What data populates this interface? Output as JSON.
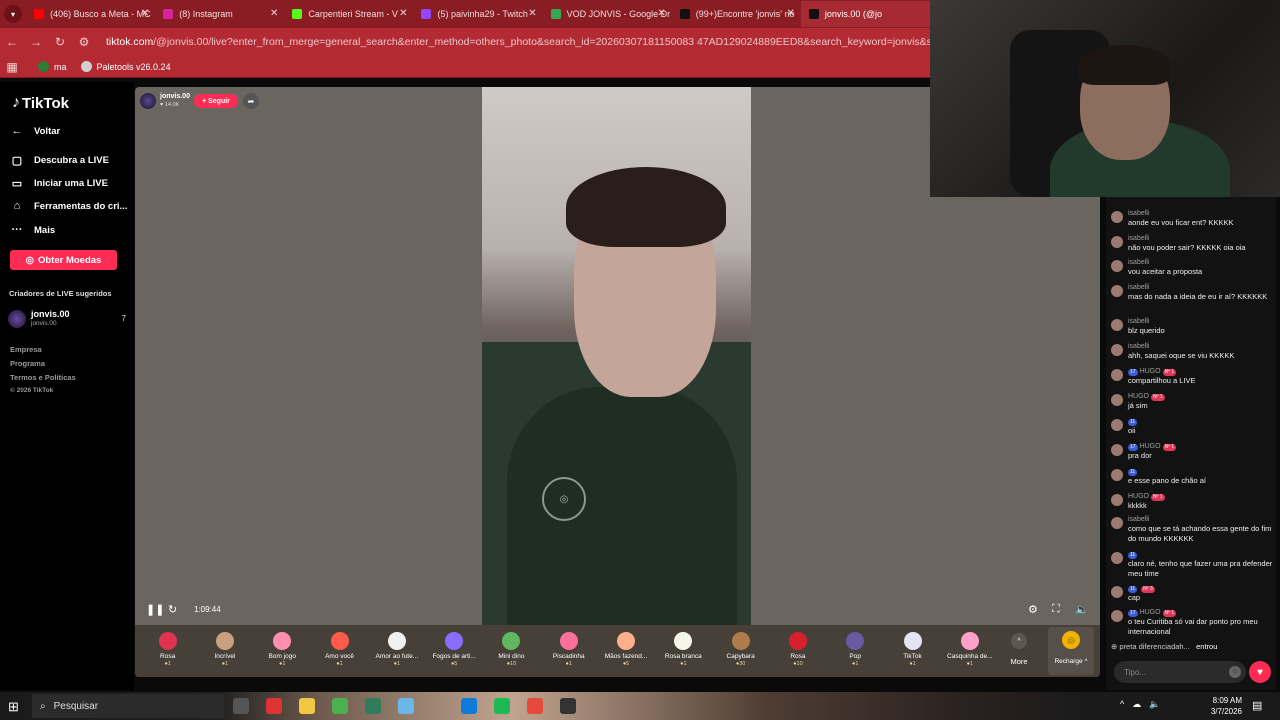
{
  "tabs": [
    {
      "title": "(406) Busco a Meta - MC",
      "color": "#ff0000"
    },
    {
      "title": "(8) Instagram",
      "color": "#d6249f"
    },
    {
      "title": "Carpentieri Stream - V",
      "color": "#53fc18"
    },
    {
      "title": "(5) paivinha29 - Twitch",
      "color": "#9146ff"
    },
    {
      "title": "VOD JONVIS - Google Dr",
      "color": "#34a853"
    },
    {
      "title": "(99+)Encontre 'jonvis' no",
      "color": "#111111"
    },
    {
      "title": "jonvis.00 (@jo",
      "color": "#111111"
    }
  ],
  "address": {
    "host": "tiktok.com",
    "rest": "/@jonvis.00/live?enter_from_merge=general_search&enter_method=others_photo&search_id=20260307181150083 47AD129024889EED8&search_keyword=jonvis&search_result_id=2422438"
  },
  "bookmarks": [
    {
      "label": "ma",
      "color": "#2e7d32"
    },
    {
      "label": "Paletools v26.0.24",
      "color": "#d0d0d0"
    }
  ],
  "sidebar": {
    "brand": "TikTok",
    "items": [
      {
        "label": "Voltar",
        "icon": "arrow-left-icon"
      },
      {
        "label": "Descubra a LIVE",
        "icon": "live-icon"
      },
      {
        "label": "Iniciar uma LIVE",
        "icon": "camera-icon"
      },
      {
        "label": "Ferramentas do cri...",
        "icon": "home-icon"
      },
      {
        "label": "Mais",
        "icon": "more-icon"
      }
    ],
    "coins": "Obter Moedas",
    "suggested_title": "Criadores de LIVE sugeridos",
    "creator": {
      "name": "jonvis.00",
      "sub": "jonvis.00",
      "count": "7"
    },
    "footer": [
      "Empresa",
      "Programa",
      "Termos e Políticas",
      "© 2026 TikTok"
    ]
  },
  "stream": {
    "host": "jonvis.00",
    "viewers": "14.0K",
    "follow": "+ Seguir",
    "time": "1:09:44"
  },
  "gifts": [
    {
      "name": "Rosa",
      "price": "1",
      "color": "#e0334f"
    },
    {
      "name": "Incrível",
      "price": "1",
      "color": "#c8a080"
    },
    {
      "name": "Bom jogo",
      "price": "1",
      "color": "#ff8fb0"
    },
    {
      "name": "Amo você",
      "price": "1",
      "color": "#ff5a4a"
    },
    {
      "name": "Amor ao fute...",
      "price": "1",
      "color": "#f0f0f0"
    },
    {
      "name": "Fogos de arti...",
      "price": "5",
      "color": "#8a6cff"
    },
    {
      "name": "Mini dino",
      "price": "10",
      "color": "#5fb85f"
    },
    {
      "name": "Piscadinha",
      "price": "1",
      "color": "#ff6f9a"
    },
    {
      "name": "Mãos fazend...",
      "price": "5",
      "color": "#ffb08a"
    },
    {
      "name": "Rosa branca",
      "price": "1",
      "color": "#f5f5e8"
    },
    {
      "name": "Capybara",
      "price": "30",
      "color": "#b07a4a"
    },
    {
      "name": "Rosa",
      "price": "10",
      "color": "#d8202c"
    },
    {
      "name": "Pop",
      "price": "1",
      "color": "#6a5aa0"
    },
    {
      "name": "TikTok",
      "price": "1",
      "color": "#e4e4f4"
    },
    {
      "name": "Casquinha de...",
      "price": "1",
      "color": "#ffa0c8"
    }
  ],
  "more_label": "More",
  "recharge_label": "Recharge ^",
  "chat": {
    "messages": [
      {
        "user": "isabelli",
        "text": "aonde eu vou ficar ent? KKKKK"
      },
      {
        "user": "isabelli",
        "text": "não vou poder sair? KKKKK oia oia"
      },
      {
        "user": "isabelli",
        "text": "vou aceitar a proposta"
      },
      {
        "user": "isabelli",
        "text": "mas do nada a ideia de eu ir aí? KKKKKK"
      },
      {
        "user": "isabelli",
        "text": "blz querido"
      },
      {
        "user": "isabelli",
        "text": "ahh, saquei oque se viu KKKKK"
      },
      {
        "user": "HUGO",
        "text": "compartilhou a LIVE",
        "badge": "17",
        "rank": "Nº 1"
      },
      {
        "user": "HUGO",
        "text": "já sim",
        "rank": "Nº 1"
      },
      {
        "user": "",
        "text": "oii",
        "badge": "11"
      },
      {
        "user": "HUGO",
        "text": "pra dor",
        "badge": "17",
        "rank": "Nº 1"
      },
      {
        "user": "",
        "text": "e esse pano de chão aí",
        "badge": "11"
      },
      {
        "user": "HUGO",
        "text": "kkkkk",
        "rank": "Nº 1"
      },
      {
        "user": "isabelli",
        "text": "como que se tá achando essa gente do fim do mundo KKKKKK"
      },
      {
        "user": "",
        "text": "claro né, tenho que fazer uma pra defender meu time",
        "badge": "11"
      },
      {
        "user": "",
        "text": "cap",
        "badge": "11",
        "rank": "Nº 3"
      },
      {
        "user": "HUGO",
        "text": "o teu Curitiba só vai dar ponto pro meu internacional",
        "badge": "17",
        "rank": "Nº 1"
      }
    ],
    "joined_user": "preta diferenciadah...",
    "joined_text": "entrou",
    "placeholder": "Tipo..."
  },
  "taskbar": {
    "search": "Pesquisar",
    "time": "8:09 AM",
    "date": "3/7/2026"
  }
}
